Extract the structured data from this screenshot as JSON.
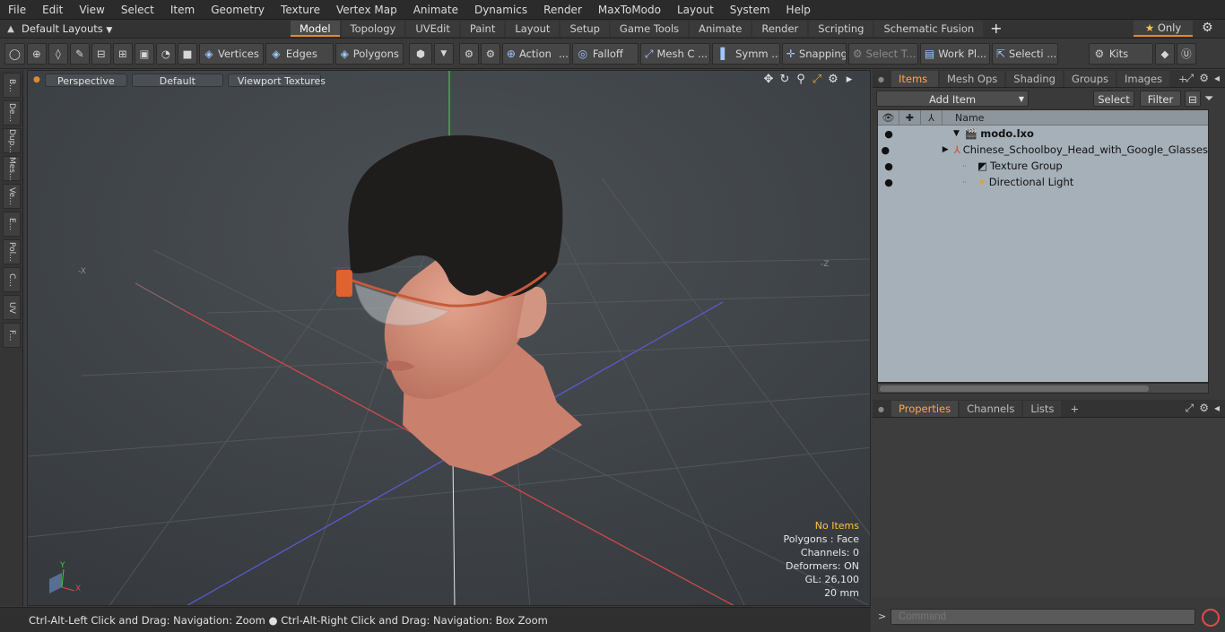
{
  "menubar": {
    "items": [
      "File",
      "Edit",
      "View",
      "Select",
      "Item",
      "Geometry",
      "Texture",
      "Vertex Map",
      "Animate",
      "Dynamics",
      "Render",
      "MaxToModo",
      "Layout",
      "System",
      "Help"
    ]
  },
  "layoutbar": {
    "layouts_label": "Default Layouts",
    "tabs": [
      "Model",
      "Topology",
      "UVEdit",
      "Paint",
      "Layout",
      "Setup",
      "Game Tools",
      "Animate",
      "Render",
      "Scripting",
      "Schematic Fusion"
    ],
    "active_tab": "Model",
    "plus": "+",
    "only_label": "Only",
    "star": "★",
    "gear": "⚙"
  },
  "toolbar": {
    "vertices": "Vertices",
    "edges": "Edges",
    "polygons": "Polygons",
    "action": "Action",
    "falloff": "Falloff",
    "mesh": "Mesh C ...",
    "symm": "Symm ...",
    "snapping": "Snapping",
    "select_t": "Select T...",
    "work_plane": "Work Pl...",
    "selecti": "Selecti ...",
    "kits": "Kits",
    "dots": "..."
  },
  "lefttabs": [
    "B...",
    "De...",
    "Dup...",
    "Mes...",
    "Ve...",
    "E...",
    "Pol...",
    "C...",
    "UV",
    "F..."
  ],
  "viewport": {
    "view": "Perspective",
    "shading": "Default",
    "textures": "Viewport Textures",
    "axis_x": "X",
    "axis_y": "Y",
    "neg_x": "-X",
    "neg_z": "-Z",
    "hud": {
      "no_items": "No Items",
      "polygons": "Polygons : Face",
      "channels": "Channels: 0",
      "deformers": "Deformers: ON",
      "gl": "GL: 26,100",
      "scale": "20 mm"
    }
  },
  "statusbar": {
    "text": "Ctrl-Alt-Left Click and Drag: Navigation: Zoom ● Ctrl-Alt-Right Click and Drag: Navigation: Box Zoom"
  },
  "items_panel": {
    "tabs": [
      "Items",
      "Mesh Ops",
      "Shading",
      "Groups",
      "Images"
    ],
    "active_tab": "Items",
    "add_item": "Add Item",
    "select": "Select",
    "filter": "Filter",
    "name_header": "Name",
    "rows": [
      {
        "name": "modo.lxo",
        "bold": true
      },
      {
        "name": "Chinese_Schoolboy_Head_with_Google_Glasses",
        "bold": false
      },
      {
        "name": "Texture Group",
        "bold": false
      },
      {
        "name": "Directional Light",
        "bold": false
      }
    ]
  },
  "props_panel": {
    "tabs": [
      "Properties",
      "Channels",
      "Lists"
    ],
    "active_tab": "Properties"
  },
  "command": {
    "placeholder": "Command"
  },
  "colors": {
    "accent": "#e08a2c",
    "hud_warning": "#ffc23c",
    "items_bg": "#a6b0b8"
  }
}
